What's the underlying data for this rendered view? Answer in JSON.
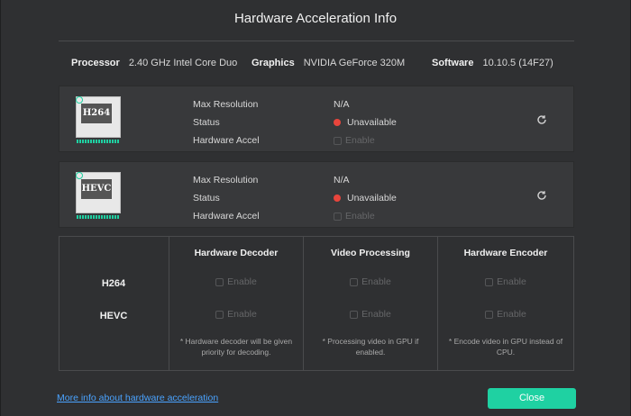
{
  "dialog": {
    "title": "Hardware Acceleration Info"
  },
  "system": {
    "processor_label": "Processor",
    "processor_value": "2.40 GHz Intel Core Duo",
    "graphics_label": "Graphics",
    "graphics_value": "NVIDIA GeForce 320M",
    "software_label": "Software",
    "software_value": "10.10.5 (14F27)"
  },
  "codecs": [
    {
      "chip_label": "H264",
      "max_resolution_label": "Max Resolution",
      "max_resolution_value": "N/A",
      "status_label": "Status",
      "status_value": "Unavailable",
      "hw_accel_label": "Hardware Accel",
      "hw_accel_value": "Enable"
    },
    {
      "chip_label": "HEVC",
      "max_resolution_label": "Max Resolution",
      "max_resolution_value": "N/A",
      "status_label": "Status",
      "status_value": "Unavailable",
      "hw_accel_label": "Hardware Accel",
      "hw_accel_value": "Enable"
    }
  ],
  "matrix": {
    "columns": [
      "Hardware Decoder",
      "Video Processing",
      "Hardware Encoder"
    ],
    "rows": [
      "H264",
      "HEVC"
    ],
    "cell_label": "Enable",
    "notes": [
      "* Hardware decoder will be given priority for decoding.",
      "* Processing video in GPU if enabled.",
      "* Encode video in GPU instead of CPU."
    ]
  },
  "footer": {
    "link_text": "More info about hardware acceleration",
    "close_label": "Close"
  },
  "colors": {
    "accent": "#1fd1a2",
    "status_red": "#e8453c",
    "link": "#4aa3ff"
  }
}
